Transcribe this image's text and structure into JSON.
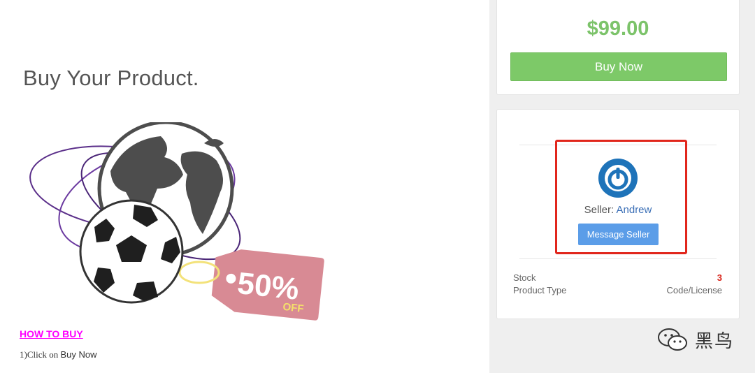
{
  "main": {
    "headline": "Buy Your Product.",
    "tag_text": "50%",
    "tag_off": "OFF",
    "how_to_buy": "HOW TO BUY",
    "step_prefix": "1)Click on ",
    "step_action": "Buy Now"
  },
  "purchase": {
    "price": "$99.00",
    "buy_button": "Buy Now"
  },
  "seller": {
    "label": "Seller: ",
    "name": "Andrew",
    "message_button": "Message Seller"
  },
  "details": {
    "stock_label": "Stock",
    "stock_value": "3",
    "type_label": "Product Type",
    "type_value": "Code/License"
  },
  "watermark": {
    "text": "黑鸟"
  },
  "colors": {
    "price_green": "#7cc36a",
    "buy_button_green": "#7dc968",
    "message_button_blue": "#5b9de8",
    "seller_link_blue": "#3b6fb6",
    "highlight_red": "#e1261c",
    "how_to_buy_magenta": "#ff00ff"
  }
}
